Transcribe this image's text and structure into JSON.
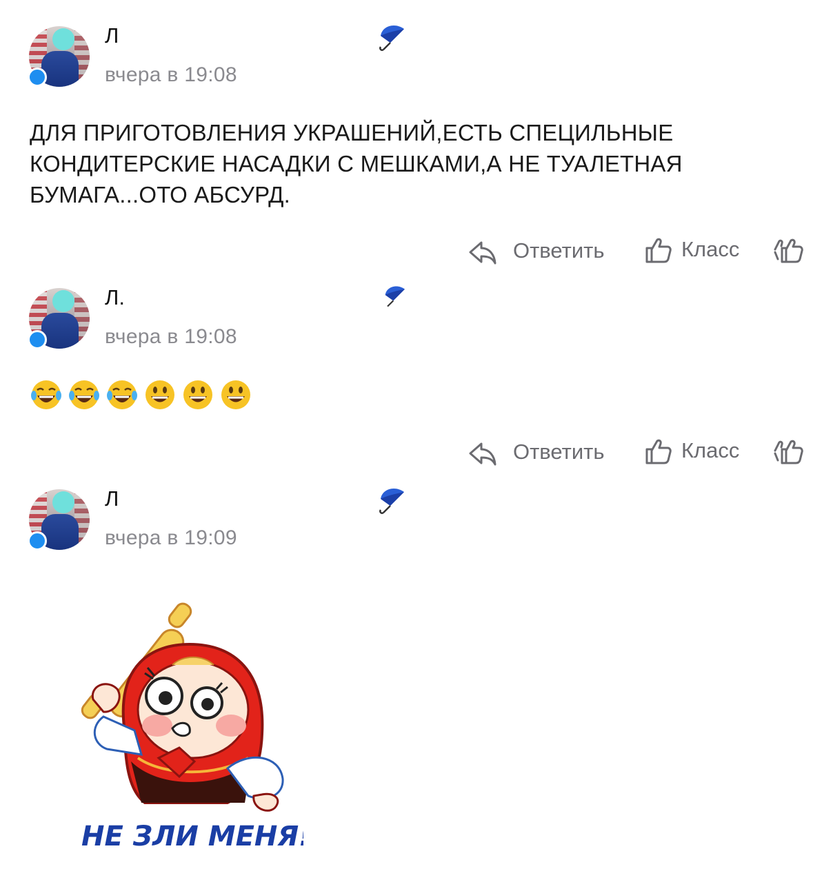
{
  "comments": [
    {
      "author": "Л",
      "time": "вчера в 19:08",
      "text": "ДЛЯ ПРИГОТОВЛЕНИЯ УКРАШЕНИЙ,ЕСТЬ СПЕЦИЛЬНЫЕ КОНДИТЕРСКИЕ НАСАДКИ С МЕШКАМИ,А НЕ ТУАЛЕТНАЯ БУМАГА...ОТО АБСУРД.",
      "reply_label": "Ответить",
      "like_label": "Класс"
    },
    {
      "author": "Л.",
      "time": "вчера в 19:08",
      "emojis": [
        "😂",
        "😂",
        "😂",
        "😃",
        "😃",
        "😃"
      ],
      "reply_label": "Ответить",
      "like_label": "Класс"
    },
    {
      "author": "Л",
      "time": "вчера в 19:09",
      "sticker_caption": "НЕ ЗЛИ МЕНЯ!"
    }
  ],
  "icons": {
    "umbrella": "umbrella-icon",
    "reply": "reply-arrow-icon",
    "like": "thumbs-up-icon",
    "reactions": "double-thumbs-up-icon"
  },
  "colors": {
    "online_dot": "#1e8ef0",
    "secondary_text": "#8a8a8f",
    "action_text": "#6b6b70",
    "sticker_caption": "#1a3ea5"
  }
}
